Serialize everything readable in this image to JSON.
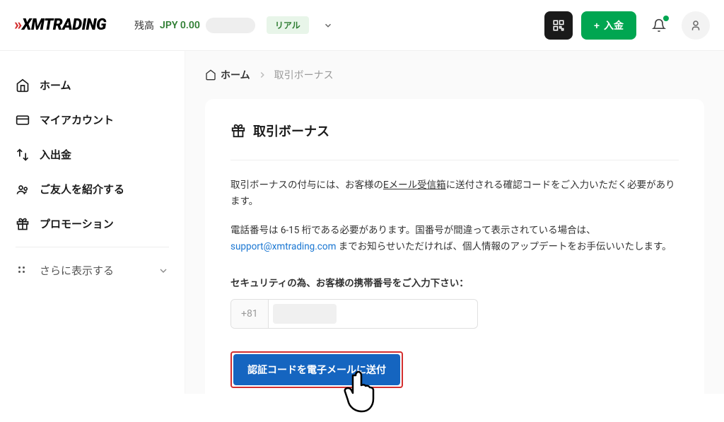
{
  "header": {
    "logo_text": "XMTRADING",
    "balance_label": "残高",
    "balance_value": "JPY 0.00",
    "account_type": "リアル",
    "deposit_label": "入金"
  },
  "sidebar": {
    "items": [
      {
        "label": "ホーム",
        "icon": "home"
      },
      {
        "label": "マイアカウント",
        "icon": "card"
      },
      {
        "label": "入出金",
        "icon": "transfer"
      },
      {
        "label": "ご友人を紹介する",
        "icon": "people"
      },
      {
        "label": "プロモーション",
        "icon": "gift"
      }
    ],
    "more_label": "さらに表示する"
  },
  "breadcrumb": {
    "home": "ホーム",
    "current": "取引ボーナス"
  },
  "card": {
    "title": "取引ボーナス",
    "text1_a": "取引ボーナスの付与には、お客様の",
    "text1_b": "Eメール受信箱",
    "text1_c": "に送付される確認コードをご入力いただく必要があります。",
    "text2_a": "電話番号は 6-15 桁である必要があります。国番号が間違って表示されている場合は、",
    "text2_link": "support@xmtrading.com",
    "text2_b": " までお知らせいただければ、個人情報のアップデートをお手伝いいたします。",
    "field_label": "セキュリティの為、お客様の携帯番号をご入力下さい：",
    "phone_prefix": "+81",
    "send_button": "認証コードを電子メールに送付"
  }
}
